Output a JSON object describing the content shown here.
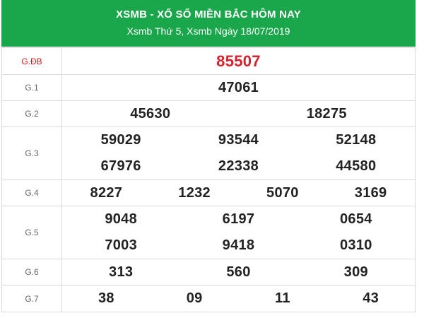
{
  "header": {
    "title": "XSMB - XỔ SỐ MIỀN BẮC HÔM NAY",
    "subtitle": "Xsmb Thứ 5, Xsmb Ngày 18/07/2019"
  },
  "colors": {
    "header_bg": "#1aa64a",
    "special_number": "#d3212d",
    "label_special": "#cc1b1b"
  },
  "prizes": {
    "gdb": {
      "label": "G.ĐB",
      "numbers": [
        "85507"
      ]
    },
    "g1": {
      "label": "G.1",
      "numbers": [
        "47061"
      ]
    },
    "g2": {
      "label": "G.2",
      "numbers": [
        "45630",
        "18275"
      ]
    },
    "g3": {
      "label": "G.3",
      "numbers": [
        "59029",
        "93544",
        "52148",
        "67976",
        "22338",
        "44580"
      ]
    },
    "g4": {
      "label": "G.4",
      "numbers": [
        "8227",
        "1232",
        "5070",
        "3169"
      ]
    },
    "g5": {
      "label": "G.5",
      "numbers": [
        "9048",
        "6197",
        "0654",
        "7003",
        "9418",
        "0310"
      ]
    },
    "g6": {
      "label": "G.6",
      "numbers": [
        "313",
        "560",
        "309"
      ]
    },
    "g7": {
      "label": "G.7",
      "numbers": [
        "38",
        "09",
        "11",
        "43"
      ]
    }
  }
}
